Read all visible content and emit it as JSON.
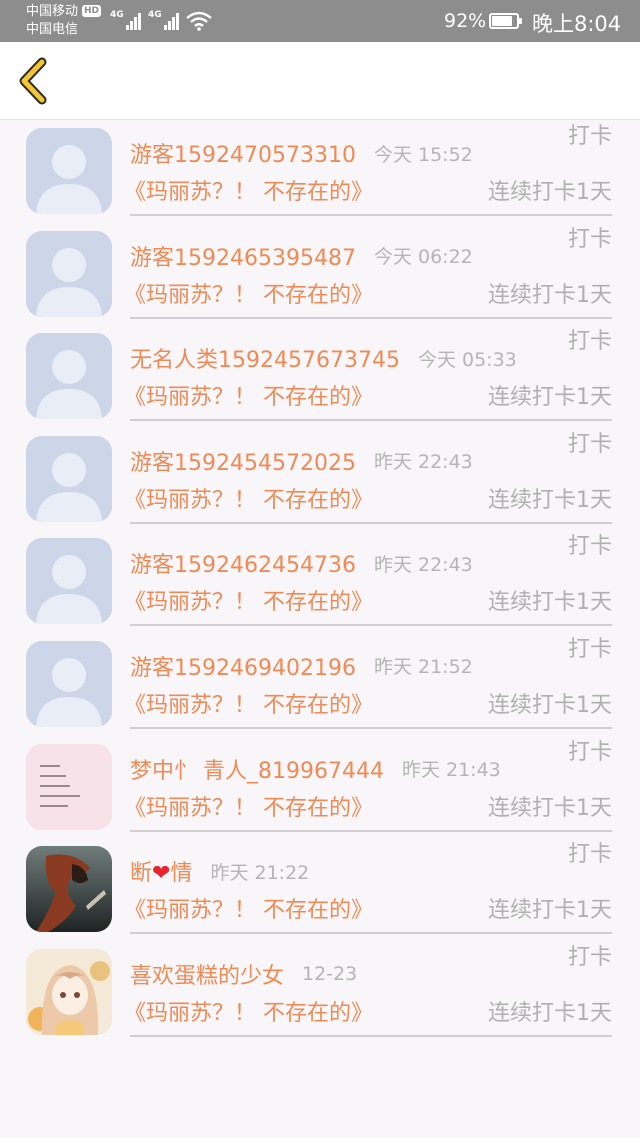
{
  "status_bar": {
    "carrier_1": "中国移动",
    "hd": "HD",
    "carrier_2": "中国电信",
    "net_1": "4G",
    "net_2": "4G",
    "battery_percent": "92%",
    "battery_level": 0.92,
    "time": "晚上8:04"
  },
  "header": {
    "back_icon": "chevron-left-icon"
  },
  "entries": [
    {
      "name": "游客1592470573310",
      "heart": "",
      "name_suffix": "",
      "time": "今天 15:52",
      "action": "打卡",
      "book": "《玛丽苏？！ 不存在的》",
      "streak": "连续打卡1天",
      "avatar": "default"
    },
    {
      "name": "游客1592465395487",
      "heart": "",
      "name_suffix": "",
      "time": "今天 06:22",
      "action": "打卡",
      "book": "《玛丽苏？！ 不存在的》",
      "streak": "连续打卡1天",
      "avatar": "default"
    },
    {
      "name": "无名人类1592457673745",
      "heart": "",
      "name_suffix": "",
      "time": "今天 05:33",
      "action": "打卡",
      "book": "《玛丽苏？！ 不存在的》",
      "streak": "连续打卡1天",
      "avatar": "default"
    },
    {
      "name": "游客1592454572025",
      "heart": "",
      "name_suffix": "",
      "time": "昨天 22:43",
      "action": "打卡",
      "book": "《玛丽苏？！ 不存在的》",
      "streak": "连续打卡1天",
      "avatar": "default"
    },
    {
      "name": "游客1592462454736",
      "heart": "",
      "name_suffix": "",
      "time": "昨天 22:43",
      "action": "打卡",
      "book": "《玛丽苏？！ 不存在的》",
      "streak": "连续打卡1天",
      "avatar": "default"
    },
    {
      "name": "游客1592469402196",
      "heart": "",
      "name_suffix": "",
      "time": "昨天 21:52",
      "action": "打卡",
      "book": "《玛丽苏？！ 不存在的》",
      "streak": "连续打卡1天",
      "avatar": "default"
    },
    {
      "name": "梦中忄 青人_819967444",
      "heart": "",
      "name_suffix": "",
      "time": "昨天 21:43",
      "action": "打卡",
      "book": "《玛丽苏？！ 不存在的》",
      "streak": "连续打卡1天",
      "avatar": "pink-text"
    },
    {
      "name": "断",
      "heart": "❤",
      "name_suffix": "情",
      "time": "昨天 21:22",
      "action": "打卡",
      "book": "《玛丽苏？！ 不存在的》",
      "streak": "连续打卡1天",
      "avatar": "dark-illustration"
    },
    {
      "name": "喜欢蛋糕的少女",
      "heart": "",
      "name_suffix": "",
      "time": "12-23",
      "action": "打卡",
      "book": "《玛丽苏？！ 不存在的》",
      "streak": "连续打卡1天",
      "avatar": "anime-girl"
    }
  ],
  "colors": {
    "accent": "#ef8a55",
    "muted": "#b0b0b0",
    "heart": "#e8242e",
    "status_bar": "#8d8d8d",
    "back_arrow": "#f2c634"
  }
}
